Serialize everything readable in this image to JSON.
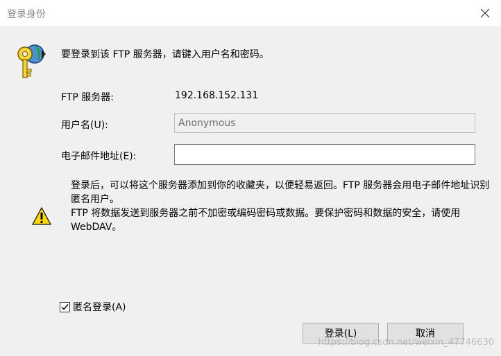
{
  "window": {
    "title": "登录身份",
    "close_icon": "close-icon"
  },
  "intro": {
    "icon": "key-globe-icon",
    "text": "要登录到该 FTP 服务器，请键入用户名和密码。"
  },
  "form": {
    "server_label": "FTP 服务器:",
    "server_value": "192.168.152.131",
    "username_label": "用户名(U):",
    "username_value": "Anonymous",
    "email_label": "电子邮件地址(E):",
    "email_value": ""
  },
  "notice": {
    "icon": "warning-icon",
    "line1": "登录后，可以将这个服务器添加到你的收藏夹，以便轻易返回。FTP 服务器会用电子邮件地址识别匿名用户。",
    "line2": "FTP 将数据发送到服务器之前不加密或编码密码或数据。要保护密码和数据的安全，请使用 WebDAV。"
  },
  "anonymous_login": {
    "label": "匿名登录(A)",
    "checked": true
  },
  "buttons": {
    "login": "登录(L)",
    "cancel": "取消"
  },
  "watermark": "https://blog.csdn.net/weixin_47746630",
  "colors": {
    "window_bg": "#f0f0f0",
    "titlebar_bg": "#ffffff",
    "warning_yellow": "#ffd700"
  }
}
